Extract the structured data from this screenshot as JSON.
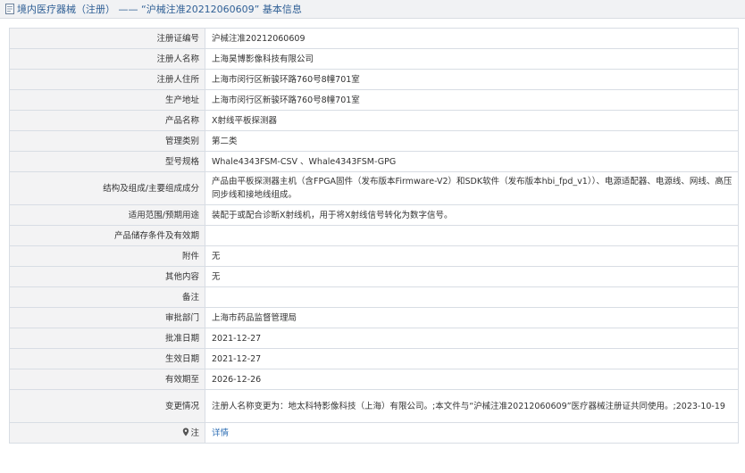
{
  "page": {
    "title": "境内医疗器械（注册） —— “沪械注准20212060609” 基本信息",
    "title_icon": "document-icon",
    "accent_color": "#2f5f95"
  },
  "rows": [
    {
      "key": "注册证编号",
      "value": "沪械注准20212060609"
    },
    {
      "key": "注册人名称",
      "value": "上海昊博影像科技有限公司"
    },
    {
      "key": "注册人住所",
      "value": "上海市闵行区新骏环路760号8幢701室"
    },
    {
      "key": "生产地址",
      "value": "上海市闵行区新骏环路760号8幢701室"
    },
    {
      "key": "产品名称",
      "value": "X射线平板探测器"
    },
    {
      "key": "管理类别",
      "value": "第二类"
    },
    {
      "key": "型号规格",
      "value": "Whale4343FSM-CSV 、Whale4343FSM-GPG"
    },
    {
      "key": "结构及组成/主要组成成分",
      "value": "产品由平板探测器主机（含FPGA固件（发布版本Firmware-V2）和SDK软件（发布版本hbi_fpd_v1））、电源适配器、电源线、网线、高压同步线和接地线组成。"
    },
    {
      "key": "适用范围/预期用途",
      "value": "装配于或配合诊断X射线机，用于将X射线信号转化为数字信号。"
    },
    {
      "key": "产品储存条件及有效期",
      "value": ""
    },
    {
      "key": "附件",
      "value": "无"
    },
    {
      "key": "其他内容",
      "value": "无"
    },
    {
      "key": "备注",
      "value": ""
    },
    {
      "key": "审批部门",
      "value": "上海市药品监督管理局"
    },
    {
      "key": "批准日期",
      "value": "2021-12-27"
    },
    {
      "key": "生效日期",
      "value": "2021-12-27"
    },
    {
      "key": "有效期至",
      "value": "2026-12-26"
    },
    {
      "key": "变更情况",
      "value": "注册人名称变更为：地太科特影像科技（上海）有限公司。;本文件与“沪械注准20212060609”医疗器械注册证共同使用。;2023-10-19"
    }
  ],
  "footer_row": {
    "key": "注",
    "key_icon": "location-pin-icon",
    "link_label": "详情",
    "link_color": "#2f6fb5"
  }
}
